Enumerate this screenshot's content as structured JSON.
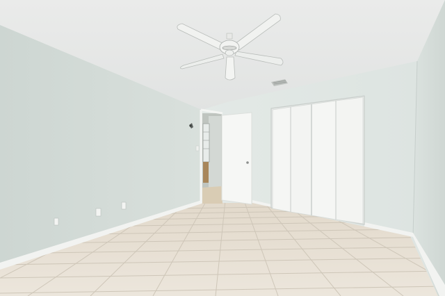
{
  "scene": {
    "description_tags": [
      "empty-bedroom",
      "ceiling-fan",
      "bifold-closet",
      "tile-floor",
      "open-door"
    ],
    "colors": {
      "ceiling": "#e6e8e7",
      "left_wall": "#d4dcd8",
      "back_wall": "#dfe6e2",
      "right_wall": "#d8dfdc",
      "baseboard": "#f3f4f2",
      "door": "#f6f7f5",
      "closet": "#f4f5f3",
      "tile": "#e9e2d6",
      "grout": "#cbc3b6",
      "hallway": "#c9cdc8",
      "fan": "#f4f4f2"
    },
    "objects": [
      "ceiling-fan",
      "air-vent",
      "wall-sconce",
      "interior-door",
      "closet-bifold-doors",
      "electrical-outlet",
      "tile-floor"
    ]
  }
}
